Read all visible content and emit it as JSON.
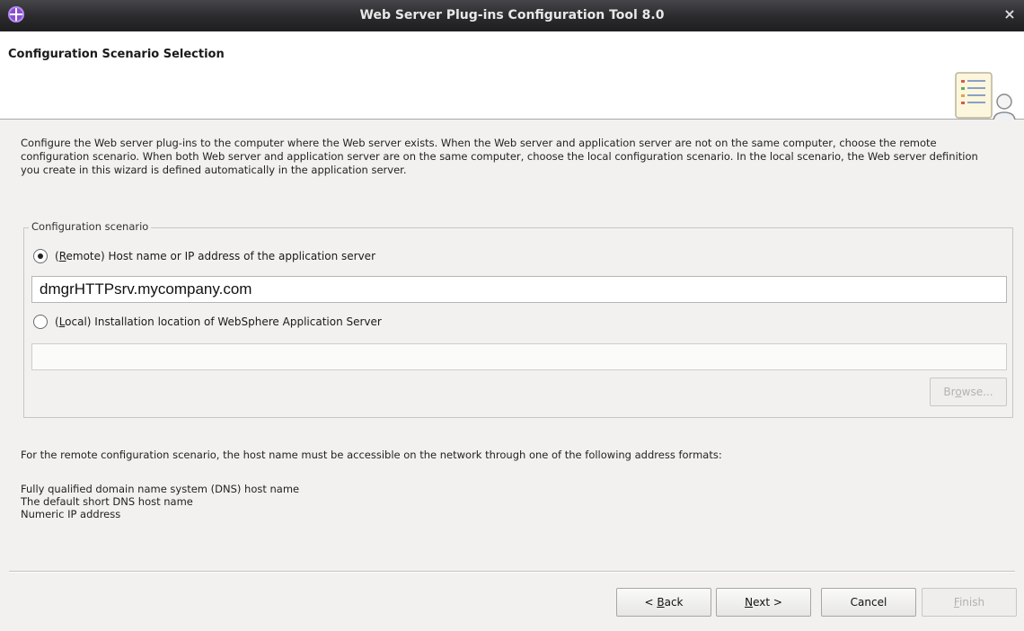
{
  "window": {
    "title": "Web Server Plug-ins Configuration Tool 8.0",
    "close_glyph": "×",
    "app_icon": "plugin-tool-icon"
  },
  "header": {
    "heading": "Configuration Scenario Selection",
    "graphic_icon": "wizard-person-document-icon"
  },
  "description": "Configure the Web server plug-ins to the computer where the Web server exists. When the Web server and application server are not on the same computer, choose the remote configuration scenario. When both Web server and application server are on the same computer, choose the local configuration scenario. In the local scenario, the Web server definition you create in this wizard is defined automatically in the application server.",
  "scenario_group": {
    "legend": "Configuration scenario",
    "remote": {
      "label_pre": "(",
      "mnemonic": "R",
      "label_post": "emote) Host name or IP address of the application server",
      "selected": true,
      "value": "dmgrHTTPsrv.mycompany.com"
    },
    "local": {
      "label_pre": "(",
      "mnemonic": "L",
      "label_post": "ocal) Installation location of WebSphere Application Server",
      "selected": false,
      "value": ""
    },
    "browse": {
      "pre": "Br",
      "mnemonic": "o",
      "post": "wse...",
      "enabled": false
    }
  },
  "info": {
    "intro": "For the remote configuration scenario, the host name must be accessible on the network through one of the following address formats:",
    "formats": [
      "Fully qualified domain name system (DNS) host name",
      "The default short DNS host name",
      "Numeric IP address"
    ]
  },
  "buttons": {
    "back": {
      "pre": "< ",
      "mnemonic": "B",
      "post": "ack",
      "enabled": true
    },
    "next": {
      "pre": "",
      "mnemonic": "N",
      "post": "ext >",
      "enabled": true
    },
    "cancel": {
      "label": "Cancel",
      "enabled": true
    },
    "finish": {
      "pre": "",
      "mnemonic": "F",
      "post": "inish",
      "enabled": false
    }
  }
}
